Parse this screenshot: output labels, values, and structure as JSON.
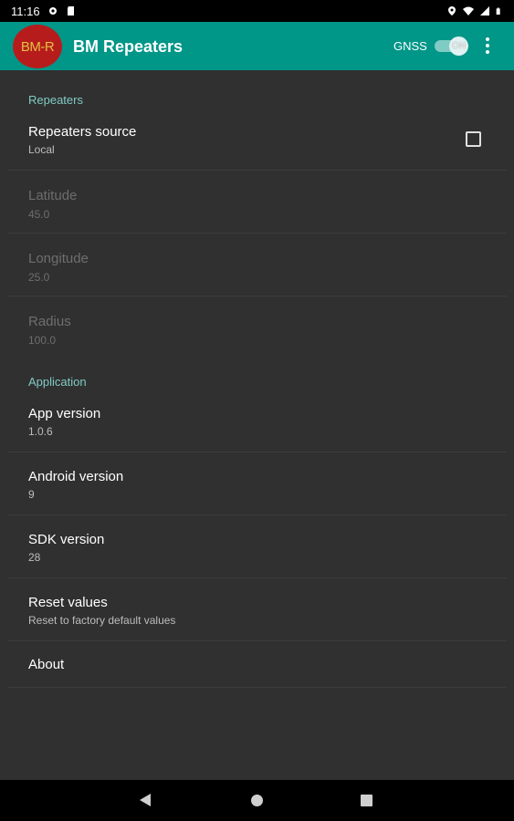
{
  "status_bar": {
    "time": "11:16",
    "left_icons": [
      "gear-icon",
      "sd-card-icon"
    ],
    "right_icons": [
      "location-icon",
      "wifi-icon",
      "signal-icon",
      "battery-icon"
    ]
  },
  "toolbar": {
    "logo_text": "BM-R",
    "title": "BM Repeaters",
    "gnss_label": "GNSS",
    "gnss_switch_text": "ON",
    "gnss_enabled": true,
    "overflow_icon": "more-vert-icon"
  },
  "categories": {
    "repeaters": "Repeaters",
    "application": "Application"
  },
  "prefs": {
    "repeaters_source": {
      "title": "Repeaters source",
      "summary": "Local",
      "checked": false
    },
    "latitude": {
      "title": "Latitude",
      "summary": "45.0",
      "enabled": false
    },
    "longitude": {
      "title": "Longitude",
      "summary": "25.0",
      "enabled": false
    },
    "radius": {
      "title": "Radius",
      "summary": "100.0",
      "enabled": false
    },
    "app_version": {
      "title": "App version",
      "summary": "1.0.6"
    },
    "android_version": {
      "title": "Android version",
      "summary": "9"
    },
    "sdk_version": {
      "title": "SDK version",
      "summary": "28"
    },
    "reset_values": {
      "title": "Reset values",
      "summary": "Reset to factory default values"
    },
    "about": {
      "title": "About"
    }
  },
  "nav_bar": {
    "icons": [
      "back-icon",
      "home-icon",
      "recents-icon"
    ]
  },
  "colors": {
    "toolbar": "#009688",
    "accent": "#80cbc4",
    "background": "#303030",
    "logo": "#b71c1c"
  }
}
